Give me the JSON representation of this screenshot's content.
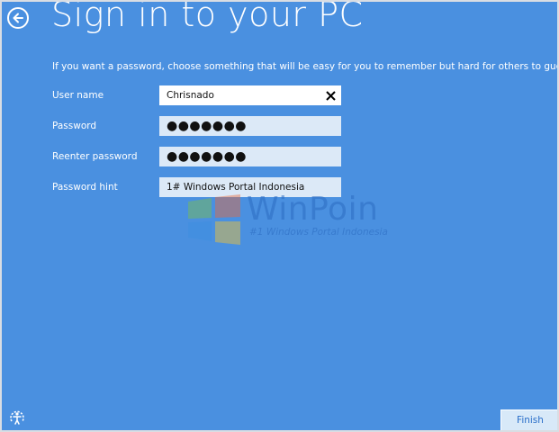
{
  "header": {
    "title": "Sign in to your PC",
    "back_icon": "arrow-left-circle-icon"
  },
  "instructions": "If you want a password, choose something that will be easy for you to remember but hard for others to guess.",
  "form": {
    "username": {
      "label": "User name",
      "value": "Chrisnado",
      "clear_icon": "close-icon"
    },
    "password": {
      "label": "Password",
      "value": "●●●●●●●"
    },
    "reenter": {
      "label": "Reenter password",
      "value": "●●●●●●●"
    },
    "hint": {
      "label": "Password hint",
      "value": "1# Windows Portal Indonesia"
    }
  },
  "watermark": {
    "name": "WinPoin",
    "tagline": "#1 Windows Portal Indonesia"
  },
  "footer": {
    "ease_of_access_icon": "ease-of-access-icon",
    "finish_label": "Finish"
  },
  "colors": {
    "background": "#4a90e0",
    "field_active": "#ffffff",
    "field_filled": "#dce9f7",
    "button_text": "#2a6fc9"
  }
}
